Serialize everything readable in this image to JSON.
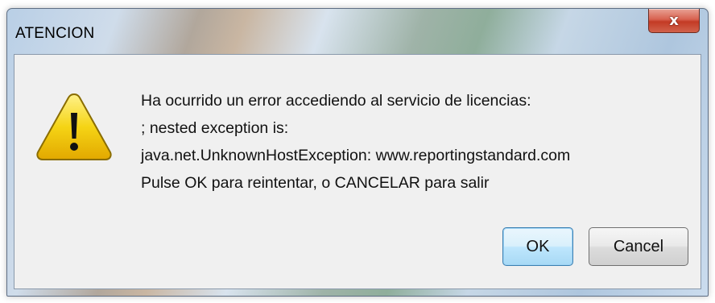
{
  "window": {
    "title": "ATENCION",
    "close_glyph": "x",
    "close_icon": "close-icon"
  },
  "dialog": {
    "icon": "warning-icon",
    "lines": [
      "Ha ocurrido un error accediendo al servicio de licencias:",
      "; nested exception is:",
      "java.net.UnknownHostException: www.reportingstandard.com",
      "Pulse OK para reintentar, o CANCELAR para salir"
    ],
    "ok_label": "OK",
    "cancel_label": "Cancel"
  },
  "colors": {
    "warning_fill": "#f5d415",
    "warning_outline": "#8a6d00",
    "close_red": "#c33a25",
    "ok_border": "#3c7fb1"
  }
}
